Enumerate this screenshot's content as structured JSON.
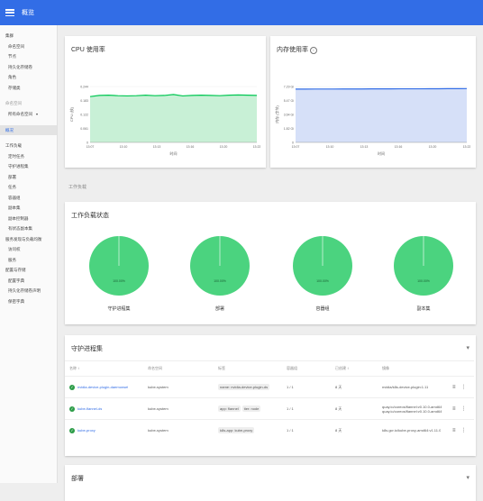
{
  "header": {
    "title": "概览"
  },
  "sidebar": {
    "cluster_section": "集群",
    "cluster_items": [
      "命名空间",
      "节点",
      "持久化存储卷",
      "角色",
      "存储类"
    ],
    "namespace_label": "命名空间",
    "namespace_value": "所有命名空间",
    "overview": "概况",
    "workloads_section": "工作负载",
    "workload_items": [
      "定时任务",
      "守护进程集",
      "部署",
      "任务",
      "容器组",
      "副本集",
      "副本控制器",
      "有状态副本集"
    ],
    "discovery_section": "服务发现与负载均衡",
    "discovery_items": [
      "访问权",
      "服务"
    ],
    "config_section": "配置与存储",
    "config_items": [
      "配置字典",
      "持久化存储卷声明",
      "保密字典"
    ]
  },
  "cpu_card": {
    "title": "CPU 使用率"
  },
  "mem_card": {
    "title": "内存使用率",
    "info_icon": "info-icon"
  },
  "workloads_label": "工作负载",
  "status_card": {
    "title": "工作负载状态",
    "donuts": [
      {
        "label": "守护进程集",
        "value": "100.00%"
      },
      {
        "label": "部署",
        "value": "100.00%"
      },
      {
        "label": "容器组",
        "value": "100.00%"
      },
      {
        "label": "副本集",
        "value": "100.00%"
      }
    ]
  },
  "daemonsets_card": {
    "title": "守护进程集",
    "columns": [
      "名称",
      "命名空间",
      "标签",
      "容器组",
      "已创建",
      "镜像"
    ],
    "rows": [
      {
        "name": "nvidia-device-plugin-daemonset",
        "namespace": "kube-system",
        "labels": [
          "name: nvidia-device-plugin-ds"
        ],
        "pods": "1 / 1",
        "created": "8 天",
        "images": [
          "nvidia/k8s-device-plugin:1.11"
        ]
      },
      {
        "name": "kube-flannel-ds",
        "namespace": "kube-system",
        "labels": [
          "app: flannel",
          "tier: node"
        ],
        "pods": "1 / 1",
        "created": "8 天",
        "images": [
          "quay.io/coreos/flannel:v0.10.0-amd64",
          "quay.io/coreos/flannel:v0.10.0-amd64"
        ]
      },
      {
        "name": "kube-proxy",
        "namespace": "kube-system",
        "labels": [
          "k8s-app: kube-proxy"
        ],
        "pods": "1 / 1",
        "created": "8 天",
        "images": [
          "k8s.gcr.io/kube-proxy-amd64:v1.11.0"
        ]
      }
    ]
  },
  "deployments_card": {
    "title": "部署"
  },
  "colors": {
    "primary": "#326de6",
    "cpu_line": "#00c752",
    "cpu_fill": "#c8f0d6",
    "mem_line": "#326de6",
    "mem_fill": "#d6e0f8",
    "donut": "#4bd37f",
    "success": "#2e9d49"
  },
  "chart_data": [
    {
      "type": "area",
      "title": "CPU 使用率",
      "xlabel": "时间",
      "ylabel": "CPU (核)",
      "y_tick_labels": [
        "0.244",
        "0.183",
        "0.122",
        "0.061",
        "0"
      ],
      "x_tick_labels": [
        "13:07",
        "13:10",
        "13:13",
        "13:16",
        "13:20",
        "13:22"
      ],
      "ylim": [
        0,
        0.244
      ],
      "series": [
        {
          "values": [
            0.2,
            0.205,
            0.206,
            0.204,
            0.203,
            0.204,
            0.206,
            0.204,
            0.205,
            0.209,
            0.203,
            0.205,
            0.206,
            0.205,
            0.204,
            0.206,
            0.207,
            0.206,
            0.205
          ]
        }
      ]
    },
    {
      "type": "area",
      "title": "内存使用率",
      "xlabel": "时间",
      "ylabel": "内存 (字节)",
      "y_tick_labels": [
        "7.29 Gi",
        "5.47 Gi",
        "3.64 Gi",
        "1.82 Gi",
        "0"
      ],
      "x_tick_labels": [
        "13:07",
        "13:10",
        "13:13",
        "13:16",
        "13:20",
        "13:22"
      ],
      "ylim": [
        0,
        7.29
      ],
      "series": [
        {
          "values": [
            6.95,
            6.95,
            6.96,
            6.96,
            6.96,
            6.97,
            6.97,
            6.97,
            6.98,
            6.98,
            6.98,
            6.99,
            6.99,
            6.99,
            7.0,
            7.0,
            7.01,
            7.01,
            7.02
          ]
        }
      ]
    },
    {
      "type": "pie",
      "title": "工作负载状态",
      "categories": [
        "守护进程集",
        "部署",
        "容器组",
        "副本集"
      ],
      "values": [
        100,
        100,
        100,
        100
      ]
    }
  ]
}
